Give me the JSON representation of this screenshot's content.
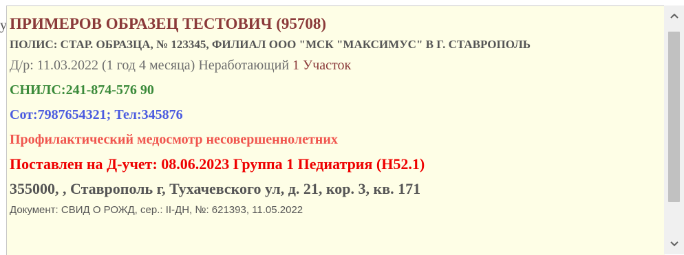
{
  "edge_fragment": "у",
  "patient": {
    "name": "ПРИМЕРОВ ОБРАЗЕЦ ТЕСТОВИЧ (95708)",
    "polis": "ПОЛИС: СТАР. ОБРАЗЦА, № 123345, ФИЛИАЛ ООО \"МСК \"МАКСИМУС\" В Г. СТАВРОПОЛЬ",
    "birth": "Д/р: 11.03.2022 (1 год 4 месяца) Неработающий",
    "uchastok": "1 Участок",
    "snils": "СНИЛС:241-874-576 90",
    "phones": "Сот:7987654321; Тел:345876",
    "prof_exam": "Профилактический медосмотр несовершеннолетних",
    "d_account": "Поставлен на Д-учет: 08.06.2023 Группа 1 Педиатрия (H52.1)",
    "address": "355000, , Ставрополь г, Тухачевского ул, д. 21, кор. 3, кв. 171",
    "document": "Документ: СВИД О РОЖД, сер.: II-ДН, №: 621393, 11.05.2022"
  },
  "scrollbar": {
    "up_icon": "chevron-up-icon",
    "down_icon": "chevron-down-icon"
  }
}
